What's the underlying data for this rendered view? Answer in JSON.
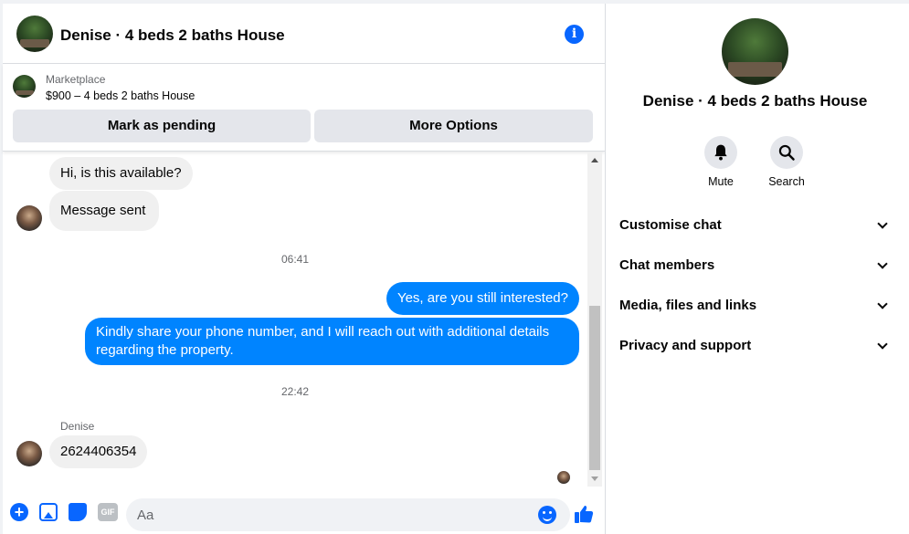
{
  "header": {
    "title": "Denise · 4 beds 2 baths House",
    "info_icon": "info-icon",
    "info_glyph": "i"
  },
  "marketplace": {
    "label": "Marketplace",
    "listing": "$900 – 4 beds 2 baths House",
    "buttons": {
      "pending": "Mark as pending",
      "more": "More Options"
    }
  },
  "messages": [
    {
      "direction": "incoming",
      "text": "Hi, is this available?"
    },
    {
      "direction": "incoming",
      "text": "Message sent"
    },
    {
      "type": "timestamp",
      "text": "06:41"
    },
    {
      "direction": "outgoing",
      "text": "Yes, are you still interested?"
    },
    {
      "direction": "outgoing",
      "text": "Kindly share your phone number, and I will reach out with additional details regarding the property."
    },
    {
      "type": "timestamp",
      "text": "22:42"
    },
    {
      "direction": "incoming",
      "sender": "Denise",
      "text": "2624406354"
    }
  ],
  "composer": {
    "placeholder": "Aa",
    "plus_glyph": "+",
    "gif_label": "GIF",
    "icons": [
      "plus-icon",
      "photo-icon",
      "sticker-icon",
      "gif-icon",
      "emoji-icon",
      "like-icon"
    ]
  },
  "info_pane": {
    "title": "Denise · 4 beds 2 baths House",
    "actions": [
      {
        "label": "Mute",
        "icon": "bell-icon"
      },
      {
        "label": "Search",
        "icon": "search-icon"
      }
    ],
    "sections": [
      {
        "label": "Customise chat"
      },
      {
        "label": "Chat members"
      },
      {
        "label": "Media, files and links"
      },
      {
        "label": "Privacy and support"
      }
    ]
  },
  "colors": {
    "accent": "#0866ff",
    "outgoing_bubble": "#0084ff",
    "incoming_bubble": "#f0f0f0",
    "button_gray": "#e4e6eb"
  }
}
